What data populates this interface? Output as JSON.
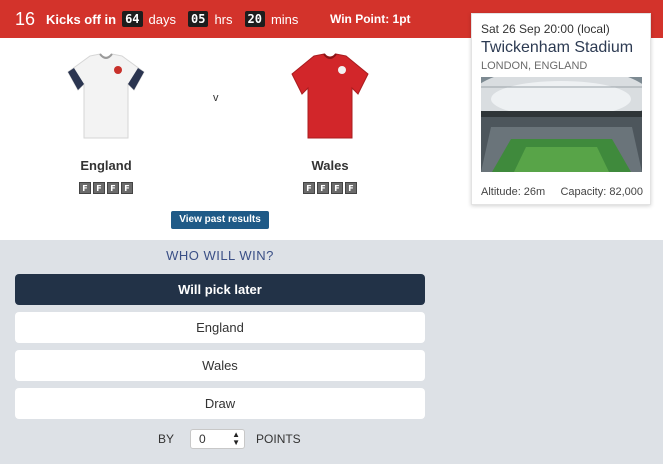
{
  "header": {
    "match_number": "16",
    "kickoff_label": "Kicks off in",
    "countdown": {
      "days_value": "64",
      "days_label": "days",
      "hrs_value": "05",
      "hrs_label": "hrs",
      "mins_value": "20",
      "mins_label": "mins"
    },
    "win_point": "Win Point: 1pt"
  },
  "venue": {
    "datetime": "Sat 26 Sep 20:00 (local)",
    "stadium": "Twickenham Stadium",
    "city": "LONDON, ENGLAND",
    "altitude": "Altitude: 26m",
    "capacity": "Capacity: 82,000"
  },
  "match": {
    "vs_label": "v",
    "home": {
      "name": "England",
      "jersey": "white-jersey-icon",
      "form": [
        "F",
        "F",
        "F",
        "F"
      ]
    },
    "away": {
      "name": "Wales",
      "jersey": "red-jersey-icon",
      "form": [
        "F",
        "F",
        "F",
        "F"
      ]
    }
  },
  "past_results_label": "View past results",
  "prediction": {
    "question": "WHO WILL WIN?",
    "options": [
      "Will pick later",
      "England",
      "Wales",
      "Draw"
    ],
    "selected": "Will pick later",
    "by_label": "BY",
    "points_value": "0",
    "points_label": "POINTS"
  },
  "colors": {
    "header": "#d3332b",
    "selected": "#223247",
    "button": "#1f5a87",
    "panel": "#dde1e6"
  }
}
